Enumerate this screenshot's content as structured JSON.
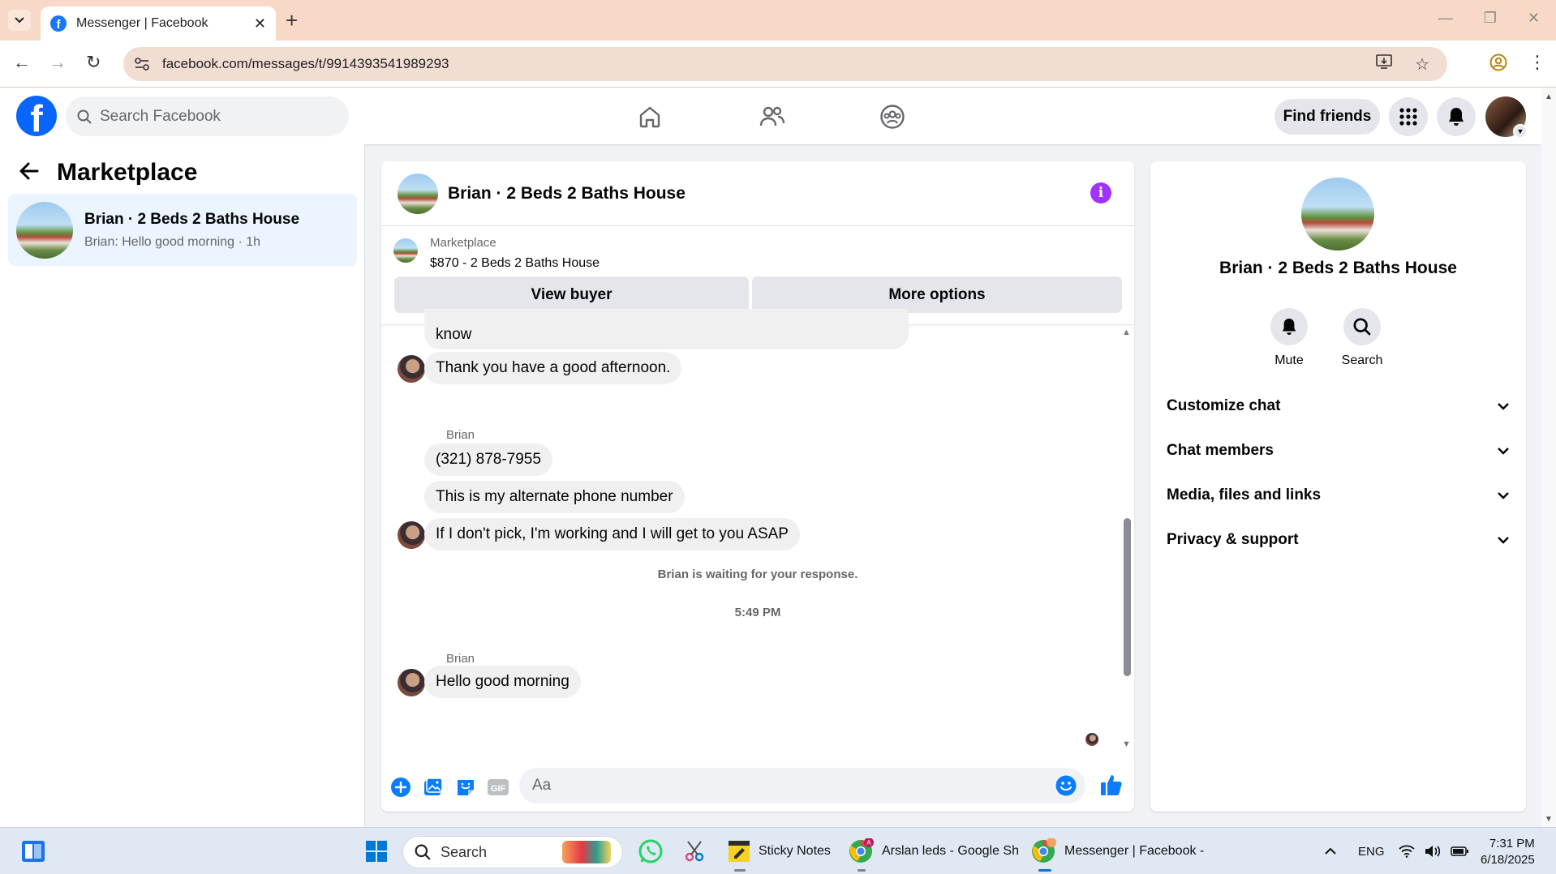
{
  "browser": {
    "tab_title": "Messenger | Facebook",
    "url": "facebook.com/messages/t/9914393541989293"
  },
  "fb": {
    "search_placeholder": "Search Facebook",
    "find_friends": "Find friends"
  },
  "sidebar": {
    "title": "Marketplace",
    "threads": [
      {
        "name": "Brian · 2 Beds 2 Baths House",
        "preview": "Brian: Hello good morning · 1h"
      }
    ]
  },
  "chat": {
    "title": "Brian · 2 Beds 2 Baths House",
    "marketplace_label": "Marketplace",
    "listing": "$870 - 2 Beds 2 Baths House",
    "view_buyer": "View buyer",
    "more_options": "More options",
    "messages": {
      "cut_off": "know",
      "m1": "Thank you have a good afternoon.",
      "sender1": "Brian",
      "m2": "(321) 878-7955",
      "m3": "This is my alternate phone number",
      "m4": "If I don't pick, I'm working and I will get to you ASAP",
      "waiting": "Brian is waiting for your response.",
      "time": "5:49 PM",
      "sender2": "Brian",
      "m5": "Hello good morning"
    },
    "composer_placeholder": "Aa"
  },
  "info_panel": {
    "name": "Brian · 2 Beds 2 Baths House",
    "actions": {
      "mute": "Mute",
      "search": "Search"
    },
    "sections": [
      "Customize chat",
      "Chat members",
      "Media, files and links",
      "Privacy & support"
    ]
  },
  "taskbar": {
    "search_placeholder": "Search",
    "apps": {
      "sticky_notes": "Sticky Notes",
      "sheets": "Arslan leds - Google Sh",
      "messenger": "Messenger | Facebook -"
    },
    "lang": "ENG",
    "time": "7:31 PM",
    "date": "6/18/2025"
  },
  "colors": {
    "fb_blue": "#0866ff",
    "messenger_blue": "#0a7cff",
    "info_purple": "#a033ff",
    "selected_thread": "#ebf5ff"
  }
}
